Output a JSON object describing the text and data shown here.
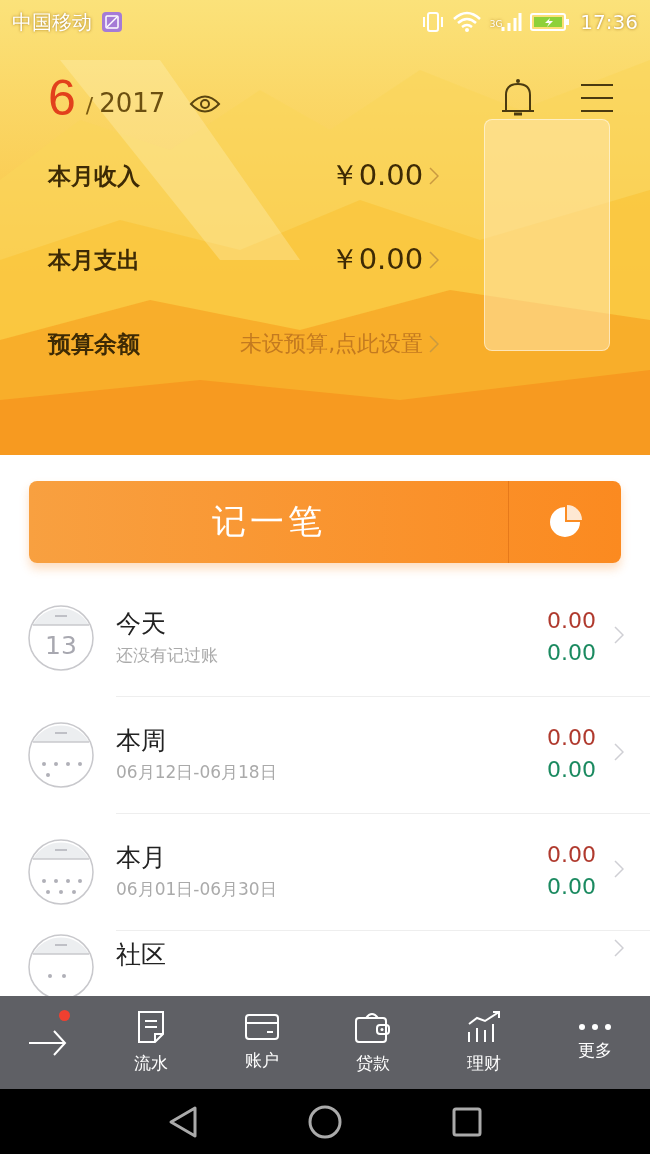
{
  "status_bar": {
    "carrier": "中国移动",
    "network": "3G",
    "time": "17:36"
  },
  "header": {
    "month": "6",
    "separator": "/",
    "year": "2017",
    "rows": [
      {
        "label": "本月收入",
        "value": "￥0.00",
        "kind": "amount"
      },
      {
        "label": "本月支出",
        "value": "￥0.00",
        "kind": "amount"
      },
      {
        "label": "预算余额",
        "value": "未设预算,点此设置",
        "kind": "hint"
      }
    ]
  },
  "record_button": {
    "label": "记一笔"
  },
  "periods": [
    {
      "kind": "day",
      "day": "13",
      "title": "今天",
      "subtitle": "还没有记过账",
      "income": "0.00",
      "expense": "0.00"
    },
    {
      "kind": "week",
      "title": "本周",
      "subtitle": "06月12日-06月18日",
      "income": "0.00",
      "expense": "0.00"
    },
    {
      "kind": "month",
      "title": "本月",
      "subtitle": "06月01日-06月30日",
      "income": "0.00",
      "expense": "0.00"
    },
    {
      "kind": "community",
      "title": "社区"
    }
  ],
  "tab_bar": {
    "has_notice": true,
    "items": [
      {
        "kind": "list",
        "label": "流水"
      },
      {
        "kind": "card",
        "label": "账户"
      },
      {
        "kind": "wallet",
        "label": "贷款"
      },
      {
        "kind": "chart",
        "label": "理财"
      },
      {
        "kind": "more",
        "label": "更多"
      }
    ]
  }
}
